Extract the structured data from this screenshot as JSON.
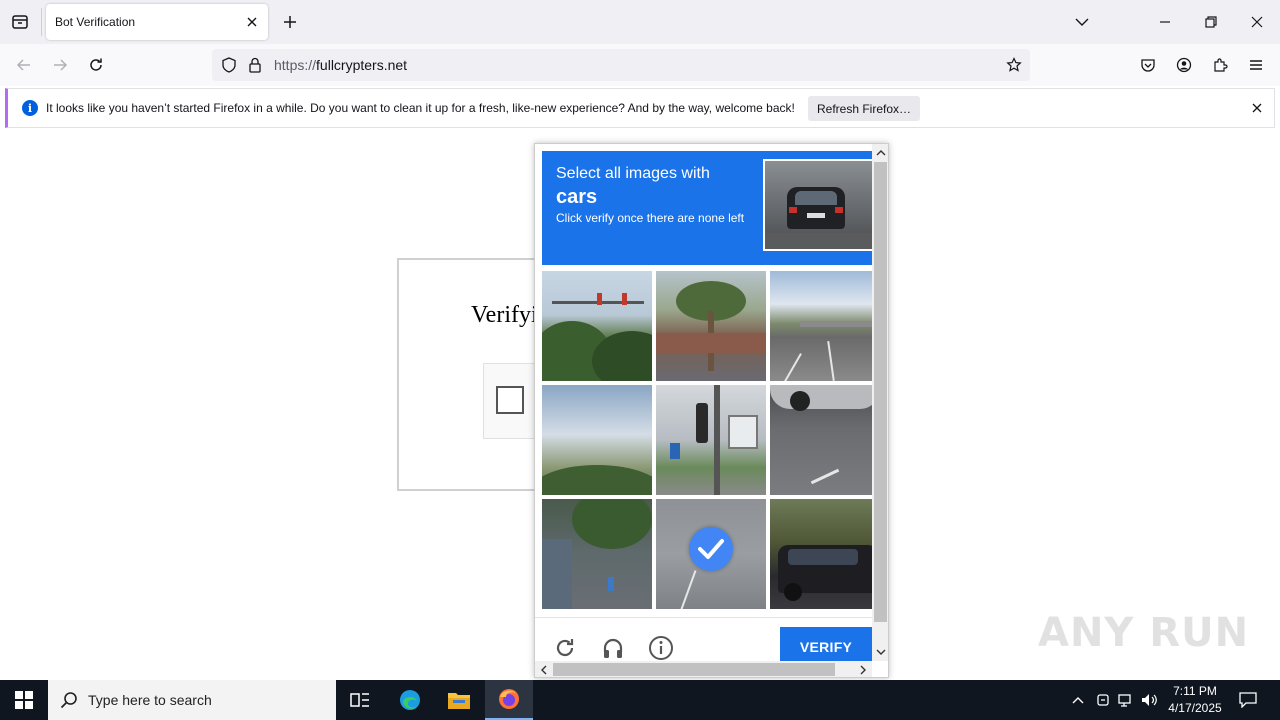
{
  "browser": {
    "tab_title": "Bot Verification",
    "url_protocol": "https://",
    "url_host": "fullcrypters.net"
  },
  "notification": {
    "message": "It looks like you haven’t started Firefox in a while. Do you want to clean it up for a fresh, like-new experience? And by the way, welcome back!",
    "button_label": "Refresh Firefox…"
  },
  "page": {
    "verify_heading": "Verifyi"
  },
  "captcha": {
    "instruction_small": "Select all images with",
    "target_object": "cars",
    "instruction_sub": "Click verify once there are none left",
    "verify_label": "VERIFY",
    "tiles": [
      {
        "scene": "traffic-lights-trees",
        "selected": false
      },
      {
        "scene": "palm-tree-building",
        "selected": false
      },
      {
        "scene": "highway-overpass",
        "selected": false
      },
      {
        "scene": "clouds-trees",
        "selected": false
      },
      {
        "scene": "traffic-signal-building",
        "selected": false
      },
      {
        "scene": "car-on-pavement",
        "selected": false
      },
      {
        "scene": "street-trees",
        "selected": false
      },
      {
        "scene": "road",
        "selected": true
      },
      {
        "scene": "suv-car",
        "selected": false
      }
    ]
  },
  "watermark": "ANY RUN",
  "taskbar": {
    "search_placeholder": "Type here to search",
    "time": "7:11 PM",
    "date": "4/17/2025"
  },
  "colors": {
    "captcha_blue": "#1a73e8",
    "checkmark_blue": "#4285f4",
    "notification_accent": "#b56cf3",
    "taskbar_bg": "#0f1620"
  }
}
